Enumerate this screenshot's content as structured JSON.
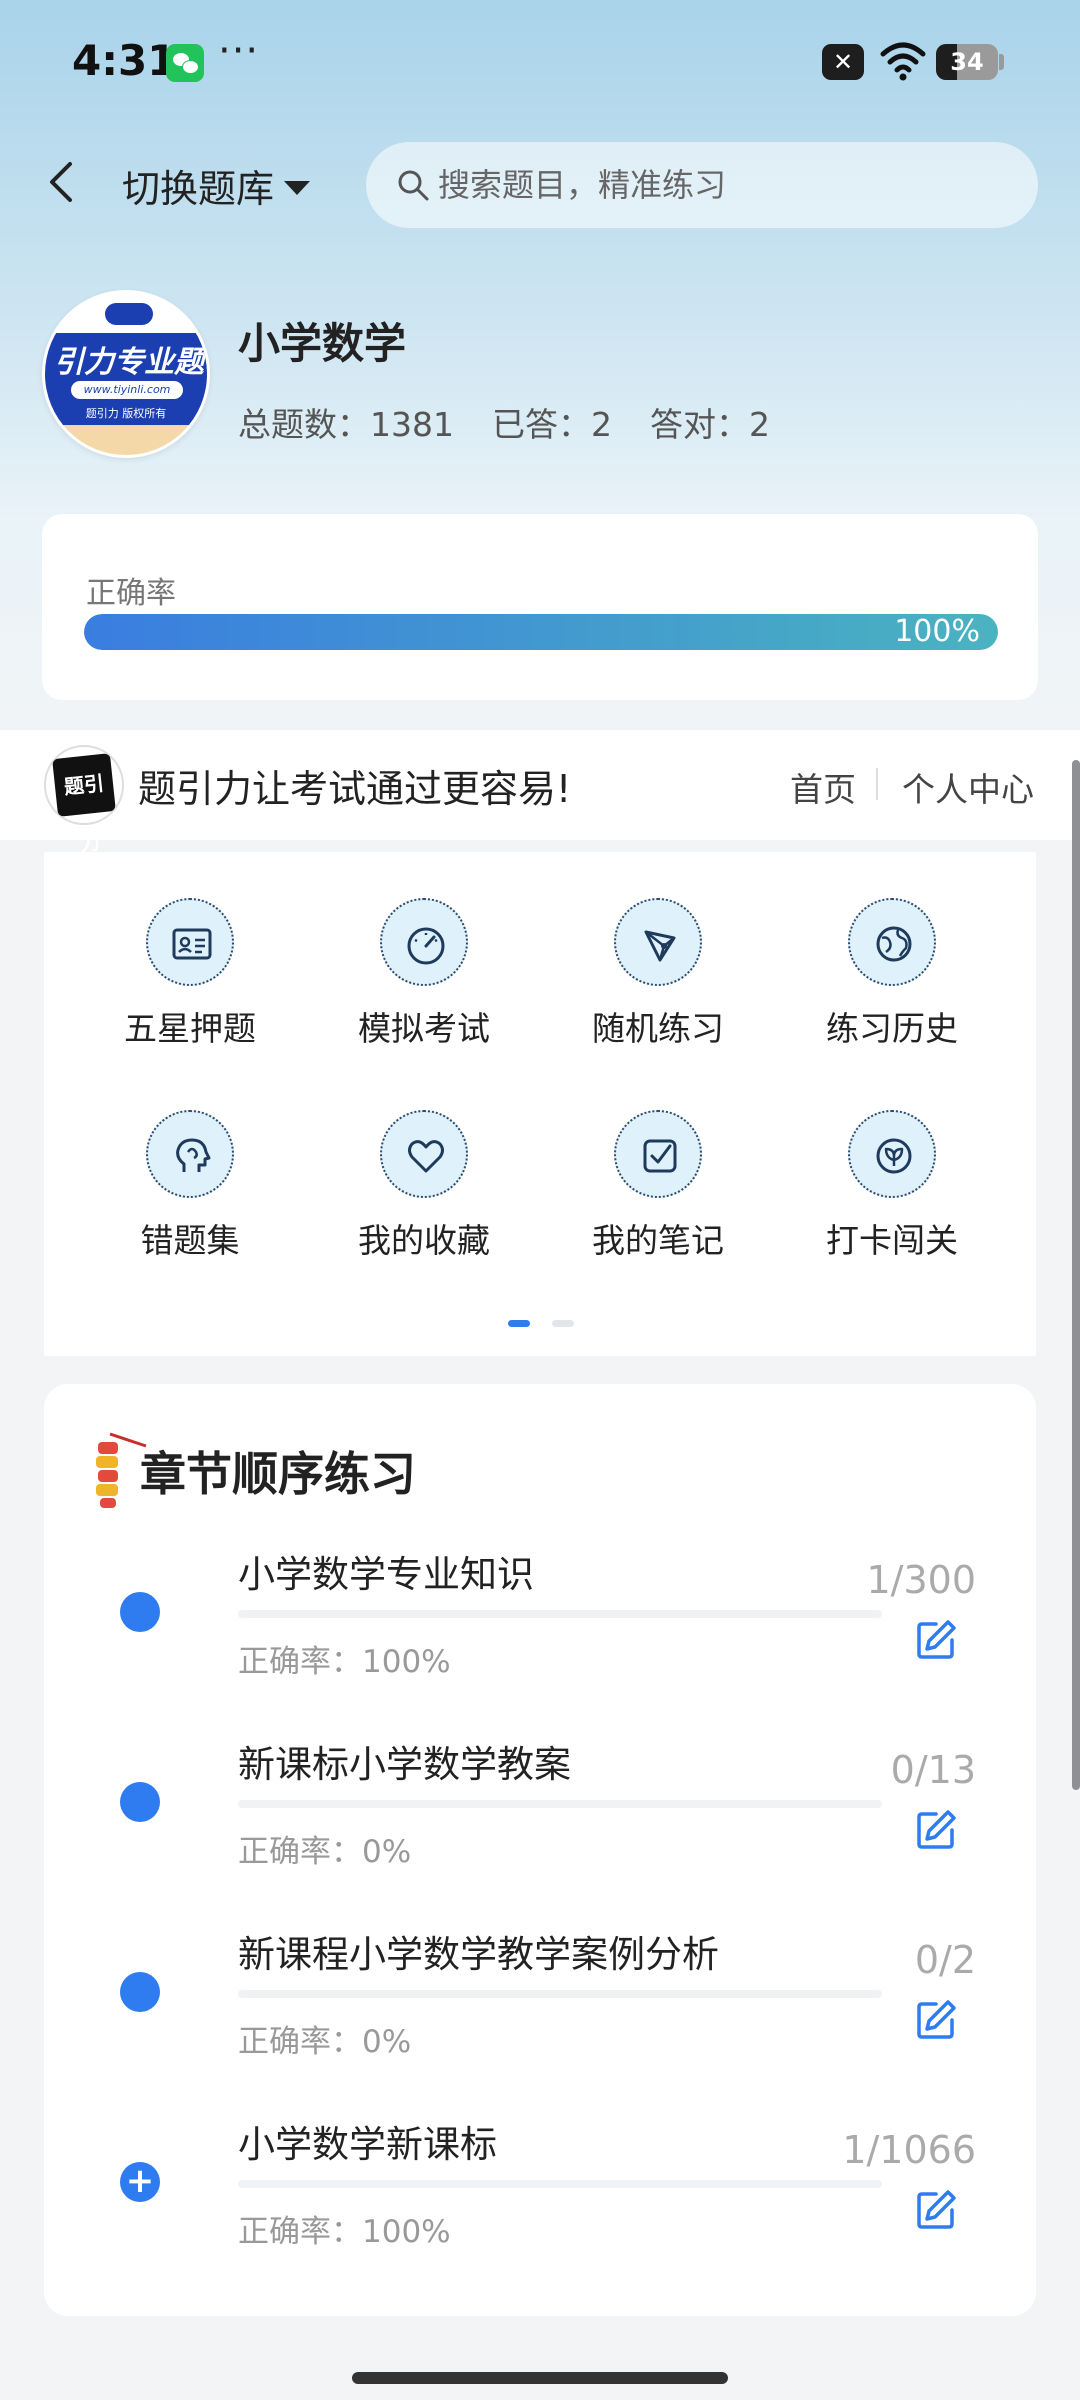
{
  "status_bar": {
    "time": "4:31",
    "dots": "···",
    "battery": "34",
    "icons": [
      "wechat-icon",
      "close-badge-icon",
      "wifi-icon",
      "battery-icon"
    ]
  },
  "header": {
    "switch_label": "切换题库",
    "search_placeholder": "搜索题目，精准练习"
  },
  "subject": {
    "logo_text": "引力专业题",
    "logo_url": "www.tiyinli.com",
    "logo_rights": "题引力 版权所有",
    "title": "小学数学",
    "total": "总题数：1381",
    "answered": "已答：2",
    "correct": "答对：2"
  },
  "accuracy": {
    "label": "正确率",
    "value_text": "100%",
    "value_percent": 100,
    "bar_colors": [
      "#3a7de0",
      "#4ab3c0"
    ]
  },
  "promo": {
    "logo_text": "题引力",
    "text": "题引力让考试通过更容易!",
    "nav_home": "首页",
    "nav_profile": "个人中心"
  },
  "grid": {
    "items": [
      {
        "label": "五星押题",
        "icon": "id-card-icon"
      },
      {
        "label": "模拟考试",
        "icon": "gauge-icon"
      },
      {
        "label": "随机练习",
        "icon": "random-node-icon"
      },
      {
        "label": "练习历史",
        "icon": "globe-icon"
      },
      {
        "label": "错题集",
        "icon": "head-icon"
      },
      {
        "label": "我的收藏",
        "icon": "heart-icon"
      },
      {
        "label": "我的笔记",
        "icon": "note-check-icon"
      },
      {
        "label": "打卡闯关",
        "icon": "leaf-badge-icon"
      }
    ],
    "page_active": 1,
    "page_count": 2
  },
  "chapters": {
    "title": "章节顺序练习",
    "items": [
      {
        "name": "小学数学专业知识",
        "accuracy": "正确率：100%",
        "count": "1/300",
        "marker": "dot"
      },
      {
        "name": "新课标小学数学教案",
        "accuracy": "正确率：0%",
        "count": "0/13",
        "marker": "dot"
      },
      {
        "name": "新课程小学数学教学案例分析",
        "accuracy": "正确率：0%",
        "count": "0/2",
        "marker": "dot"
      },
      {
        "name": "小学数学新课标",
        "accuracy": "正确率：100%",
        "count": "1/1066",
        "marker": "plus"
      }
    ],
    "accent_color": "#2f7bf0"
  }
}
